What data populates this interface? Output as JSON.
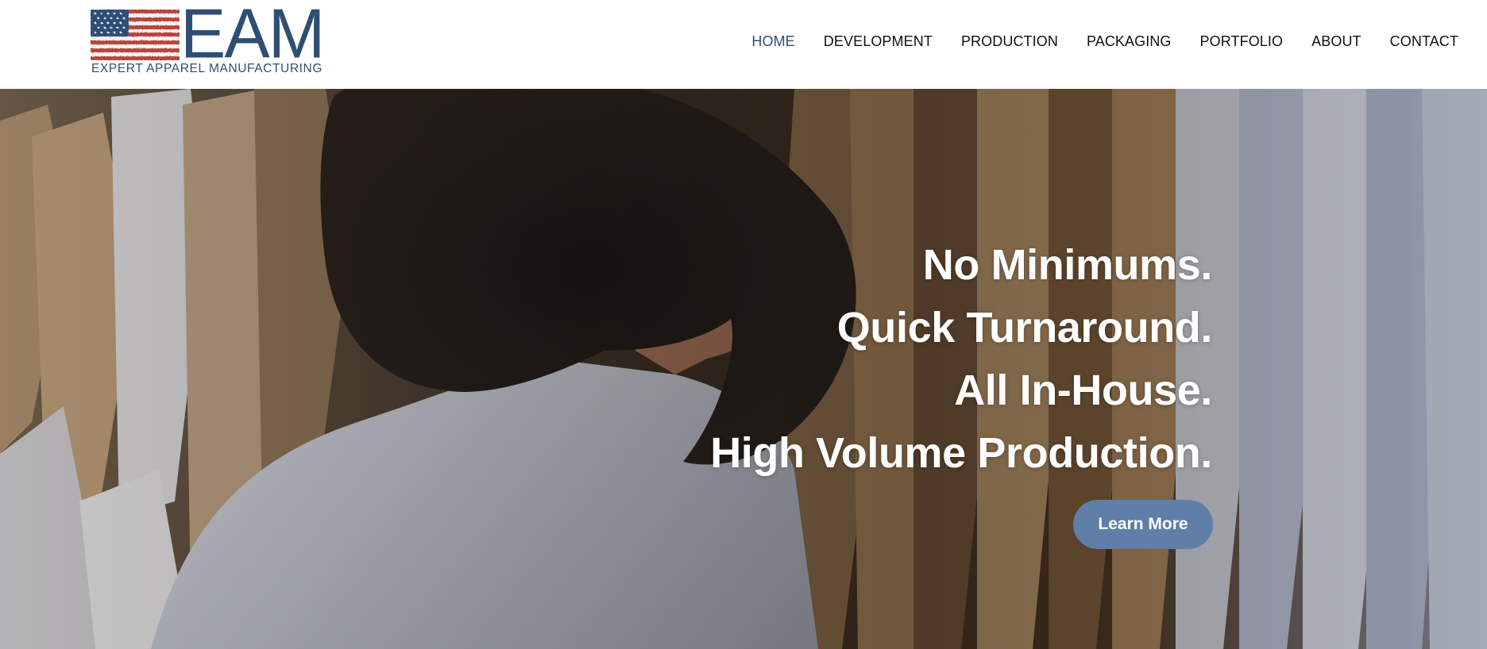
{
  "brand": {
    "name": "EAM",
    "tagline": "EXPERT APPAREL MANUFACTURING",
    "logo_icon": "us-flag-icon",
    "color": "#2f4e74"
  },
  "nav": {
    "items": [
      {
        "label": "HOME",
        "active": true
      },
      {
        "label": "DEVELOPMENT",
        "active": false
      },
      {
        "label": "PRODUCTION",
        "active": false
      },
      {
        "label": "PACKAGING",
        "active": false
      },
      {
        "label": "PORTFOLIO",
        "active": false
      },
      {
        "label": "ABOUT",
        "active": false
      },
      {
        "label": "CONTACT",
        "active": false
      }
    ]
  },
  "hero": {
    "lines": [
      "No Minimums.",
      "Quick Turnaround.",
      "All In-House.",
      "High Volume Production."
    ],
    "cta_label": "Learn More",
    "cta_color": "#5f7fa9"
  }
}
